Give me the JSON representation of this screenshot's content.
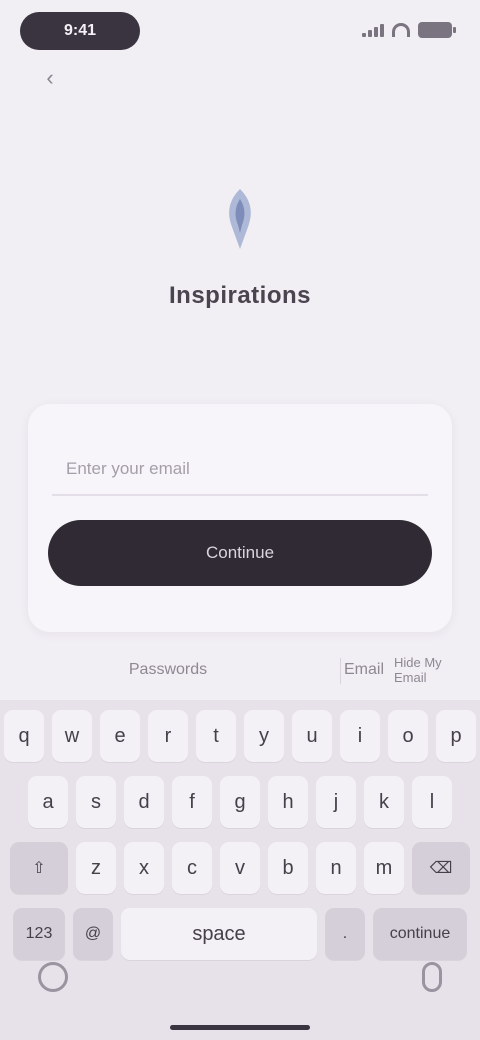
{
  "status_bar": {
    "time": "9:41",
    "icons": [
      "signal-icon",
      "wifi-icon",
      "battery-icon"
    ]
  },
  "nav": {
    "back_icon": "chevron-left-icon",
    "back_glyph": "‹"
  },
  "brand": {
    "logo_icon": "brand-logo-icon",
    "name": "Inspirations"
  },
  "login": {
    "email_placeholder": "Enter your email",
    "email_value": "",
    "continue_label": "Continue"
  },
  "keyboard": {
    "suggestions": [
      "Passwords",
      "Email",
      "Hide My Email"
    ],
    "rows": [
      [
        "q",
        "w",
        "e",
        "r",
        "t",
        "y",
        "u",
        "i",
        "o",
        "p"
      ],
      [
        "a",
        "s",
        "d",
        "f",
        "g",
        "h",
        "j",
        "k",
        "l"
      ],
      [
        "z",
        "x",
        "c",
        "v",
        "b",
        "n",
        "m"
      ]
    ],
    "shift_glyph": "⇧",
    "delete_glyph": "⌫",
    "numbers_label": "123",
    "space_label": "space",
    "at_label": "@",
    "dot_label": ".",
    "return_label": "continue"
  },
  "colors": {
    "background": "#f1eef4",
    "button": "#2f2a33",
    "card": "#f7f5f9",
    "keyboard": "#e7e2ea"
  }
}
